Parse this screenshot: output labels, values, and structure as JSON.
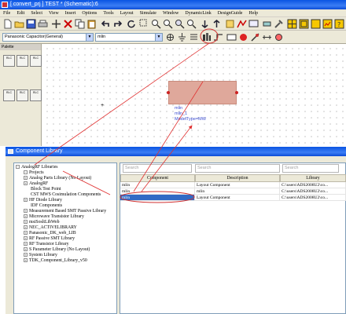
{
  "window": {
    "title": "[ convert_prj ] TEST * (Schematic):6"
  },
  "menu": [
    "File",
    "Edit",
    "Select",
    "View",
    "Insert",
    "Options",
    "Tools",
    "Layout",
    "Simulate",
    "Window",
    "DynamicLink",
    "DesignGuide",
    "Help"
  ],
  "toolbar": {
    "library_combo": "Panasonic Capacitor(General)",
    "component_combo": "mlin"
  },
  "palette": {
    "title": "Palette",
    "items": [
      "RLC",
      "RLC",
      "RLC",
      "RLC",
      "RLC",
      "RLC"
    ]
  },
  "schematic": {
    "component": {
      "name_label": "mlin",
      "instance_label": "mlin_1",
      "param_label": "ModelType=MW"
    }
  },
  "component_library": {
    "title": "Component Library",
    "tree": [
      {
        "label": "AnalogRF Libraries",
        "expander": "−",
        "level": 0
      },
      {
        "label": "Projects",
        "expander": "−",
        "level": 1
      },
      {
        "label": "Analog Parts Library (No Layout)",
        "expander": "+",
        "level": 1
      },
      {
        "label": "AnalogRF",
        "expander": "+",
        "level": 1
      },
      {
        "label": "Block Test Point",
        "expander": "",
        "level": 1
      },
      {
        "label": "CST MWS Cosimulation Components",
        "expander": "",
        "level": 1
      },
      {
        "label": "HF Diode Library",
        "expander": "+",
        "level": 1
      },
      {
        "label": "IDF Components",
        "expander": "",
        "level": 1
      },
      {
        "label": "Measurement Based SMT Passive Library",
        "expander": "+",
        "level": 1
      },
      {
        "label": "Microwave Transistor Library",
        "expander": "+",
        "level": 1
      },
      {
        "label": "msiSosltLibWeb",
        "expander": "+",
        "level": 1
      },
      {
        "label": "NEC_ACTIVELIBRARY",
        "expander": "+",
        "level": 1
      },
      {
        "label": "Panasonic_DK_web_LIB",
        "expander": "+",
        "level": 1
      },
      {
        "label": "RF Passive SMT Library",
        "expander": "+",
        "level": 1
      },
      {
        "label": "RF Transistor Library",
        "expander": "+",
        "level": 1
      },
      {
        "label": "S Parameter Library (No Layout)",
        "expander": "+",
        "level": 1
      },
      {
        "label": "System Library",
        "expander": "+",
        "level": 1
      },
      {
        "label": "TDK_Component_Library_v50",
        "expander": "+",
        "level": 1
      }
    ],
    "search_placeholder": "Search",
    "columns": [
      "Component",
      "Description",
      "Library"
    ],
    "rows": [
      {
        "component": "mlin",
        "description": "Layout Component",
        "library": "C:\\users\\ADS2008U2\\co..."
      },
      {
        "component": "mlin",
        "description": "mlin",
        "library": "C:\\users\\ADS2008U2\\co..."
      },
      {
        "component": "mlin",
        "description": "Layout Component",
        "library": "C:\\users\\ADS2008U2\\co..."
      }
    ],
    "selected_row": 2
  },
  "colors": {
    "titlebar": "#0a54e2",
    "component_fill": "#dfa89b",
    "pin": "#cc2222",
    "annotation_line": "#e03030",
    "highlight_ellipse": "#d03030",
    "selection": "#316ac5"
  }
}
